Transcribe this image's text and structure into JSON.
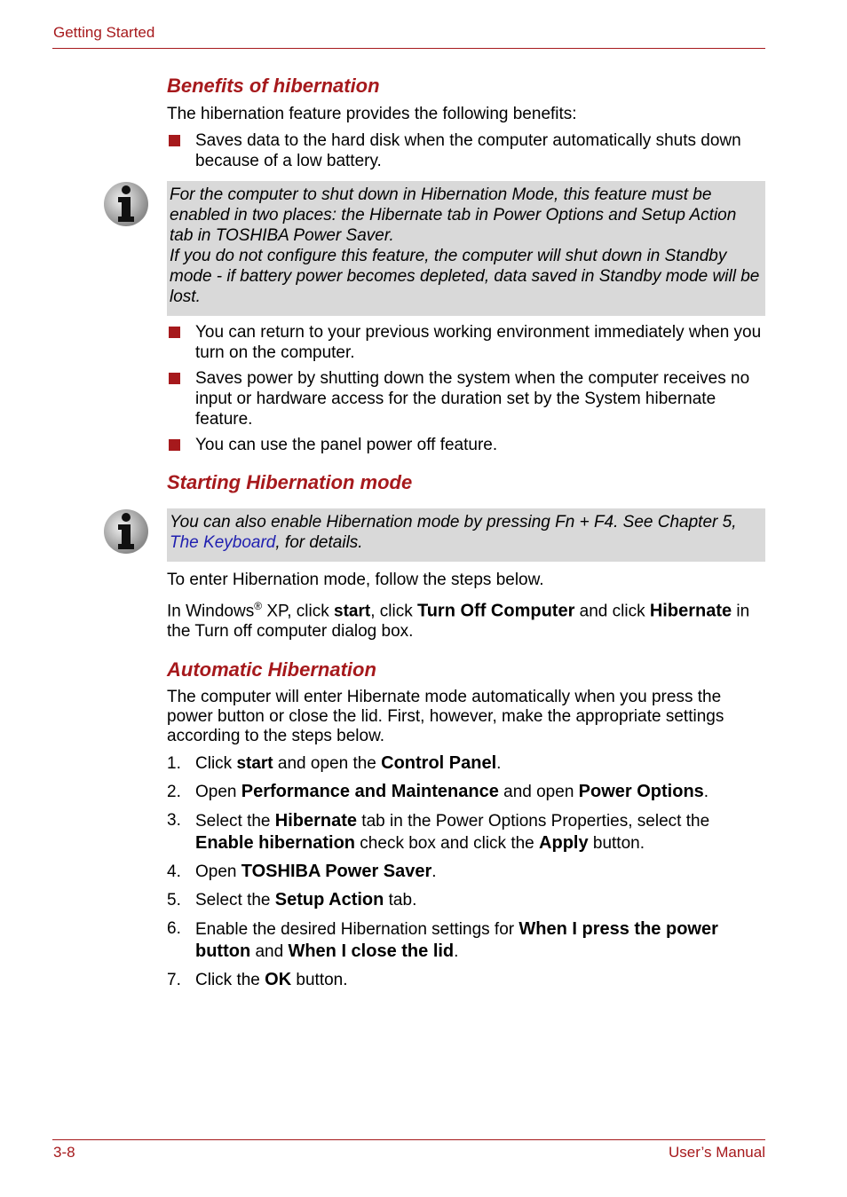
{
  "header": {
    "section": "Getting Started"
  },
  "footer": {
    "page_number": "3-8",
    "manual_title": "User’s Manual"
  },
  "benefits": {
    "heading": "Benefits of hibernation",
    "intro": "The hibernation feature provides the following benefits:",
    "bullet1": "Saves data to the hard disk when the computer automatically shuts down because of a low battery.",
    "note_line1": "For the computer to shut down in Hibernation Mode, this feature must be enabled in two places: the Hibernate tab in Power Options and Setup Action tab in TOSHIBA Power Saver.",
    "note_line2": "If you do not configure this feature, the computer will shut down in Standby mode - if battery power becomes depleted, data saved in Standby mode will be lost.",
    "bullet2": "You can return to your previous working environment immediately when you turn on the computer.",
    "bullet3": "Saves power by shutting down the system when the computer receives no input or hardware access for the duration set by the System hibernate feature.",
    "bullet4": "You can use the panel power off feature."
  },
  "starting": {
    "heading": "Starting Hibernation mode",
    "note_pre": "You can also enable Hibernation mode by pressing Fn + F4. See Chapter 5, ",
    "note_link": "The Keyboard",
    "note_post": ", for details.",
    "steps_intro": "To enter Hibernation mode, follow the steps below.",
    "instr": {
      "t1": "In Windows",
      "reg": "®",
      "t2": " XP, click ",
      "b1": "start",
      "t3": ", click ",
      "b2": "Turn Off Computer",
      "t4": " and click ",
      "b3": "Hibernate",
      "t5": " in the Turn off computer dialog box."
    }
  },
  "automatic": {
    "heading": "Automatic Hibernation",
    "intro": "The computer will enter Hibernate mode automatically when you press the power button or close the lid. First, however, make the appropriate settings according to the steps below.",
    "steps": [
      {
        "num": "1.",
        "a": "Click ",
        "b": "start",
        "c": " and open the ",
        "d": "Control Panel",
        "e": "."
      },
      {
        "num": "2.",
        "a": "Open ",
        "b": "Performance and Maintenance",
        "c": " and open ",
        "d": "Power Options",
        "e": "."
      },
      {
        "num": "3.",
        "a": "Select the ",
        "b": "Hibernate",
        "c": " tab in the Power Options Properties, select the ",
        "d": "Enable hibernation",
        "e": " check box and click the ",
        "f": "Apply",
        "g": " button."
      },
      {
        "num": "4.",
        "a": "Open ",
        "b": "TOSHIBA Power Saver",
        "c": "."
      },
      {
        "num": "5.",
        "a": "Select the ",
        "b": "Setup Action",
        "c": " tab."
      },
      {
        "num": "6.",
        "a": "Enable the desired Hibernation settings for ",
        "b": "When I press the power button",
        "c": " and ",
        "d": "When I close the lid",
        "e": "."
      },
      {
        "num": "7.",
        "a": "Click the ",
        "b": "OK",
        "c": " button."
      }
    ]
  },
  "icons": {
    "note": "info-icon",
    "bullet": "square-bullet"
  },
  "colors": {
    "accent": "#a6191c",
    "note_bg": "#d9d9d9",
    "link": "#1f1fb0"
  }
}
